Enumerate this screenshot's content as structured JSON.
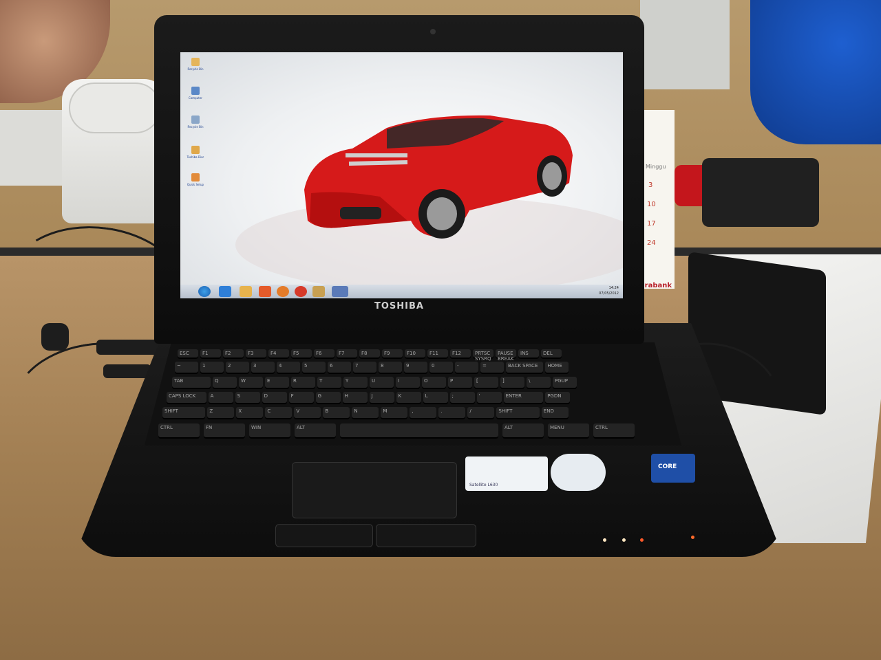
{
  "laptop": {
    "brand": "TOSHIBA",
    "model_sticker": "Satellite L630",
    "cpu_badge": "CORE"
  },
  "desktop": {
    "icons": [
      {
        "label": "Recycle Bin",
        "icon": "folder-icon"
      },
      {
        "label": "Computer",
        "icon": "computer-icon"
      },
      {
        "label": "Recycle Bin",
        "icon": "recycle-bin-icon"
      },
      {
        "label": "Toshiba Disc",
        "icon": "disc-icon"
      },
      {
        "label": "Quick Setup",
        "icon": "setup-icon"
      }
    ],
    "wallpaper": "red-sports-car"
  },
  "taskbar": {
    "time": "14:24",
    "date": "07/05/2012",
    "pinned": [
      "start-orb-icon",
      "ie-icon",
      "folder-icon",
      "media-player-icon",
      "firefox-icon",
      "chrome-icon",
      "explorer-icon",
      "app-icon"
    ]
  },
  "keyboard": {
    "row_fn": [
      "ESC",
      "F1",
      "F2",
      "F3",
      "F4",
      "F5",
      "F6",
      "F7",
      "F8",
      "F9",
      "F10",
      "F11",
      "F12",
      "PRTSC SYSRQ",
      "PAUSE BREAK",
      "INS",
      "DEL"
    ],
    "row_num": [
      "~",
      "1",
      "2",
      "3",
      "4",
      "5",
      "6",
      "7",
      "8",
      "9",
      "0",
      "-",
      "=",
      "BACK SPACE",
      "HOME"
    ],
    "row_q": [
      "TAB",
      "Q",
      "W",
      "E",
      "R",
      "T",
      "Y",
      "U",
      "I",
      "O",
      "P",
      "[",
      "]",
      "\\",
      "PGUP"
    ],
    "row_a": [
      "CAPS LOCK",
      "A",
      "S",
      "D",
      "F",
      "G",
      "H",
      "J",
      "K",
      "L",
      ";",
      "'",
      "ENTER",
      "PGDN"
    ],
    "row_z": [
      "SHIFT",
      "Z",
      "X",
      "C",
      "V",
      "B",
      "N",
      "M",
      ",",
      ".",
      "/",
      "SHIFT",
      "END"
    ],
    "row_bottom": [
      "CTRL",
      "FN",
      "WIN",
      "ALT",
      "",
      "ALT",
      "MENU",
      "CTRL"
    ]
  },
  "calendar": {
    "header": "Minggu",
    "days": [
      "3",
      "10",
      "17",
      "24"
    ]
  },
  "background_text": {
    "bank_logo": "utarabank"
  }
}
